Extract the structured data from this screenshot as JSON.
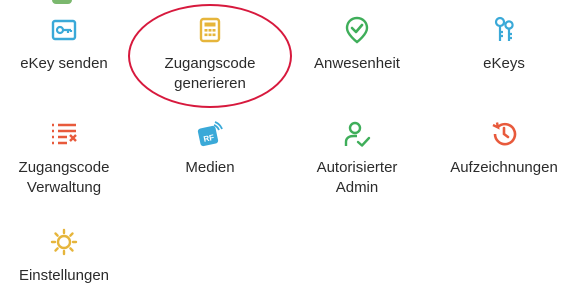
{
  "menu": {
    "tiles": [
      {
        "id": "ekey-send",
        "label_line1": "eKey senden",
        "label_line2": "",
        "icon": "key-card-icon",
        "color": "#3aa9d8"
      },
      {
        "id": "generate-passcode",
        "label_line1": "Zugangscode",
        "label_line2": "generieren",
        "icon": "keypad-icon",
        "color": "#e6b53b"
      },
      {
        "id": "attendance",
        "label_line1": "Anwesenheit",
        "label_line2": "",
        "icon": "check-pin-icon",
        "color": "#3fae5a"
      },
      {
        "id": "ekeys",
        "label_line1": "eKeys",
        "label_line2": "",
        "icon": "keys-icon",
        "color": "#3aa9d8"
      },
      {
        "id": "passcode-management",
        "label_line1": "Zugangscode",
        "label_line2": "Verwaltung",
        "icon": "list-cross-icon",
        "color": "#e85a3c"
      },
      {
        "id": "media",
        "label_line1": "Medien",
        "label_line2": "",
        "icon": "rf-card-icon",
        "color": "#3aa9d8"
      },
      {
        "id": "authorized-admin",
        "label_line1": "Autorisierter",
        "label_line2": "Admin",
        "icon": "user-check-icon",
        "color": "#3fae5a"
      },
      {
        "id": "records",
        "label_line1": "Aufzeichnungen",
        "label_line2": "",
        "icon": "history-icon",
        "color": "#e85a3c"
      },
      {
        "id": "settings",
        "label_line1": "Einstellungen",
        "label_line2": "",
        "icon": "sun-gear-icon",
        "color": "#e6b53b"
      }
    ],
    "highlight": {
      "target": "generate-passcode",
      "color": "#d7193d"
    }
  }
}
